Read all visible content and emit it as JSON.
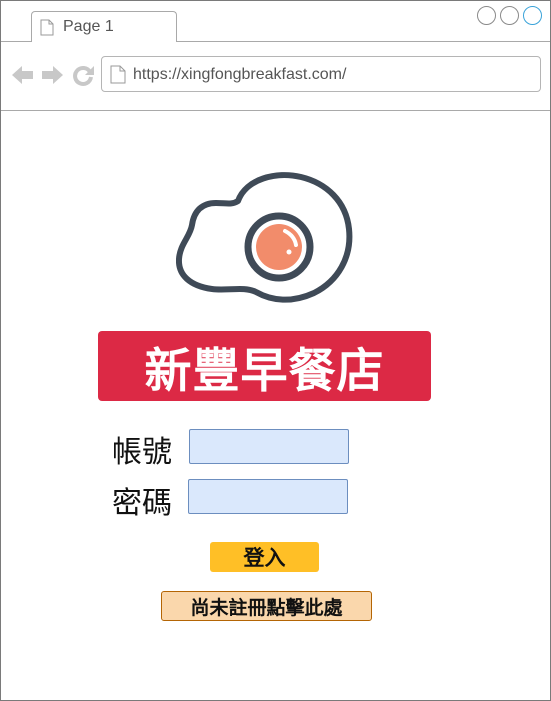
{
  "browser": {
    "tab_title": "Page 1",
    "url": "https://xingfongbreakfast.com/",
    "icons": {
      "back": "arrow-left-icon",
      "forward": "arrow-right-icon",
      "reload": "reload-icon",
      "page": "document-icon"
    }
  },
  "brand": {
    "name": "新豐早餐店",
    "logo_icon": "fried-egg-icon",
    "banner_color": "#dc2945"
  },
  "login_form": {
    "account_label": "帳號",
    "account_value": "",
    "password_label": "密碼",
    "password_value": "",
    "login_button": "登入",
    "register_button": "尚未註冊點擊此處"
  },
  "colors": {
    "input_fill": "#dae8fc",
    "input_border": "#6c8ebf",
    "login_fill": "#ffbf26",
    "register_fill": "#fad7ac",
    "register_border": "#b46504",
    "egg_outline": "#3f4a57",
    "yolk": "#f28c6b"
  }
}
